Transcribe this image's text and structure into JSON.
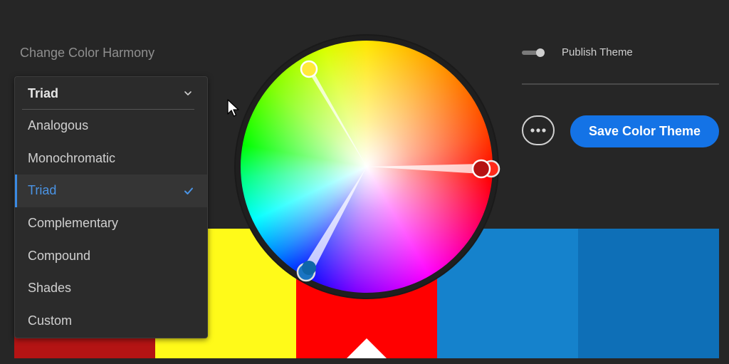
{
  "harmony": {
    "label": "Change Color Harmony",
    "selected": "Triad",
    "options": [
      "Analogous",
      "Monochromatic",
      "Triad",
      "Complementary",
      "Compound",
      "Shades",
      "Custom"
    ]
  },
  "publish": {
    "label": "Publish Theme",
    "enabled": false
  },
  "actions": {
    "more_icon": "ellipsis-icon",
    "save_label": "Save Color Theme"
  },
  "swatches": [
    "#b41414",
    "#fffa19",
    "#ff0000",
    "#1582cc",
    "#0e6fb7"
  ],
  "wheel_handles": [
    {
      "color": "#ffea3a",
      "role": "yellow"
    },
    {
      "color": "#b51212",
      "role": "red-base"
    },
    {
      "color": "#0f66a8",
      "role": "blue"
    }
  ],
  "colors": {
    "accent": "#1473e6",
    "background": "#262626"
  }
}
